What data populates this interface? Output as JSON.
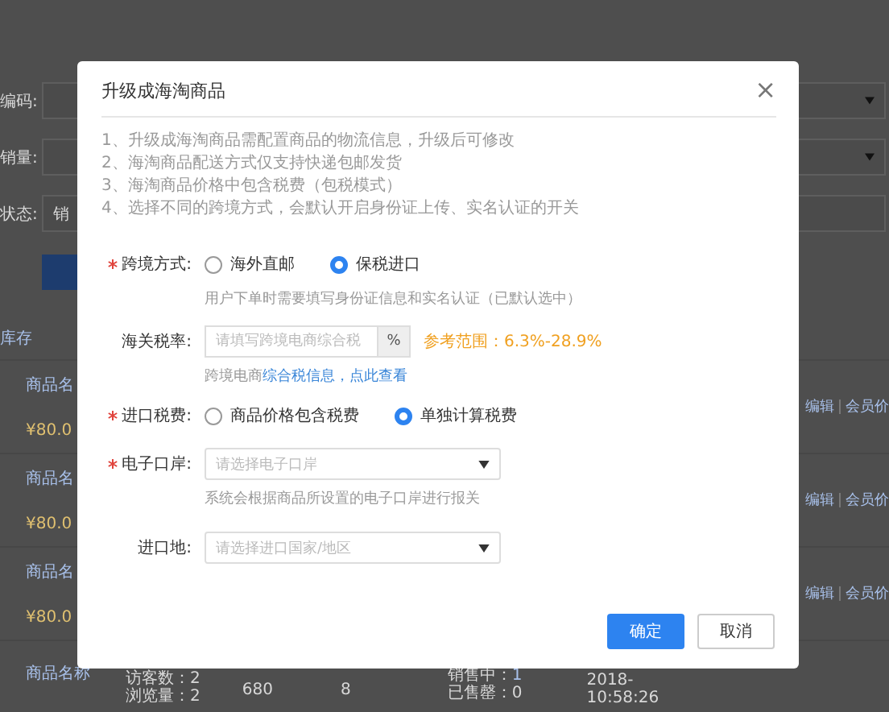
{
  "page": {
    "filters": [
      {
        "label": "编码:",
        "caret": true
      },
      {
        "label": "销量:",
        "caret": true
      },
      {
        "label": "状态:",
        "value": "销",
        "caret": false
      }
    ],
    "table_header": "库存",
    "rows": [
      {
        "name": "商品名",
        "price": "¥80.0",
        "actions": [
          "编辑",
          "会员价"
        ]
      },
      {
        "name": "商品名",
        "price": "¥80.0",
        "actions": [
          "编辑",
          "会员价"
        ]
      },
      {
        "name": "商品名",
        "price": "¥80.0",
        "actions": [
          "编辑",
          "会员价"
        ]
      }
    ],
    "last_row": {
      "name": "商品名称",
      "visitors": "访客数：2",
      "views": "浏览量：2",
      "column_3": "680",
      "column_4": "8",
      "on_sale": "销售中：",
      "on_sale_count": "1",
      "sold_out": "已售罄：0",
      "date": "2018-",
      "time": "10:58:26"
    }
  },
  "dialog": {
    "title": "升级成海淘商品",
    "close": "×",
    "notes": [
      "1、升级成海淘商品需配置商品的物流信息，升级后可修改",
      "2、海淘商品配送方式仅支持快递包邮发货",
      "3、海淘商品价格中包含税费（包税模式）",
      "4、选择不同的跨境方式，会默认开启身份证上传、实名认证的开关"
    ],
    "fields": [
      {
        "kind": "radio",
        "label": "跨境方式:",
        "required": true,
        "options": [
          {
            "label": "海外直邮",
            "selected": false
          },
          {
            "label": "保税进口",
            "selected": true
          }
        ],
        "hint": "用户下单时需要填写身份证信息和实名认证（已默认选中）"
      },
      {
        "kind": "input",
        "label": "海关税率:",
        "required": false,
        "placeholder": "请填写跨境电商综合税",
        "addon": "%",
        "note": "参考范围：6.3%-28.9%",
        "hint": "跨境电商",
        "hint_link": "综合税信息，点此查看"
      },
      {
        "kind": "radio",
        "label": "进口税费:",
        "required": true,
        "options": [
          {
            "label": "商品价格包含税费",
            "selected": false
          },
          {
            "label": "单独计算税费",
            "selected": true
          }
        ]
      },
      {
        "kind": "select",
        "label": "电子口岸:",
        "required": true,
        "placeholder": "请选择电子口岸",
        "hint": "系统会根据商品所设置的电子口岸进行报关"
      },
      {
        "kind": "select",
        "label": "进口地:",
        "required": false,
        "placeholder": "请选择进口国家/地区"
      }
    ],
    "buttons": [
      {
        "label": "确定",
        "primary": true
      },
      {
        "label": "取消",
        "primary": false
      }
    ]
  }
}
